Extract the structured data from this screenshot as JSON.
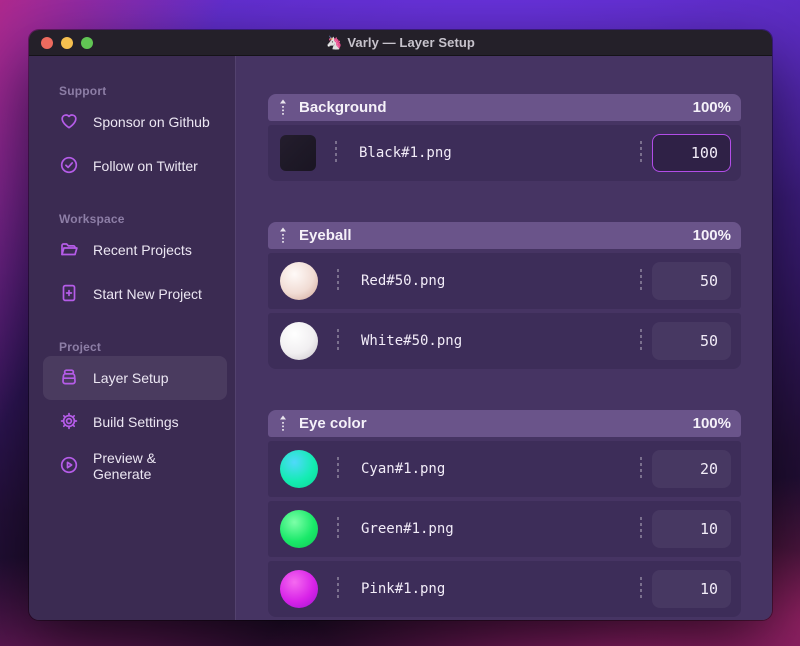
{
  "window": {
    "title": "Varly — Layer Setup",
    "app_icon": "🦄",
    "traffic_lights": {
      "close": "#ed6a5e",
      "minimize": "#f5bf4f",
      "zoom": "#61c554"
    }
  },
  "colors": {
    "accent_icon": "#b55ce8",
    "focused_input_border": "#b24de8",
    "sidebar_bg": "#3b2b52",
    "main_bg": "#463463",
    "group_header_bg": "#6a548a",
    "row_bg": "#3d2d59"
  },
  "sidebar": {
    "sections": [
      {
        "label": "Support",
        "items": [
          {
            "icon": "heart",
            "label": "Sponsor on Github",
            "active": false
          },
          {
            "icon": "check-circle",
            "label": "Follow on Twitter",
            "active": false
          }
        ]
      },
      {
        "label": "Workspace",
        "items": [
          {
            "icon": "folder",
            "label": "Recent Projects",
            "active": false
          },
          {
            "icon": "file-plus",
            "label": "Start New Project",
            "active": false
          }
        ]
      },
      {
        "label": "Project",
        "items": [
          {
            "icon": "archive",
            "label": "Layer Setup",
            "active": true
          },
          {
            "icon": "gear",
            "label": "Build Settings",
            "active": false
          },
          {
            "icon": "play-circle",
            "label": "Preview & Generate",
            "active": false
          }
        ]
      }
    ]
  },
  "main": {
    "groups": [
      {
        "title": "Background",
        "percent": "100%",
        "drag_icon": "drag-vertical",
        "layers": [
          {
            "thumb_shape": "square",
            "thumb_colors": [
              "#241d2d",
              "#1e1927",
              "#1a1522"
            ],
            "filename": "Black#1.png",
            "value": "100",
            "focused": true
          }
        ]
      },
      {
        "title": "Eyeball",
        "percent": "100%",
        "drag_icon": "drag-vertical",
        "layers": [
          {
            "thumb_shape": "sphere",
            "thumb_colors": [
              "#fffaf8",
              "#f1dcd4",
              "#cfa496"
            ],
            "filename": "Red#50.png",
            "value": "50",
            "focused": false
          },
          {
            "thumb_shape": "sphere",
            "thumb_colors": [
              "#ffffff",
              "#f1eff1",
              "#c8c2c8"
            ],
            "filename": "White#50.png",
            "value": "50",
            "focused": false
          }
        ]
      },
      {
        "title": "Eye color",
        "percent": "100%",
        "drag_icon": "drag-vertical",
        "layers": [
          {
            "thumb_shape": "sphere",
            "thumb_colors": [
              "#4fd9fb",
              "#14ecb2",
              "#0bd694"
            ],
            "filename": "Cyan#1.png",
            "value": "20",
            "focused": false
          },
          {
            "thumb_shape": "sphere",
            "thumb_colors": [
              "#7dffa8",
              "#1ae96a",
              "#0fc653"
            ],
            "filename": "Green#1.png",
            "value": "10",
            "focused": false
          },
          {
            "thumb_shape": "sphere",
            "thumb_colors": [
              "#f56af0",
              "#d823e8",
              "#9d13d0"
            ],
            "filename": "Pink#1.png",
            "value": "10",
            "focused": false
          }
        ]
      }
    ]
  }
}
